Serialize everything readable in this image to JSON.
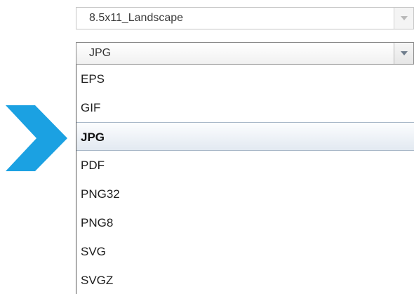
{
  "paper_size": {
    "value": "8.5x11_Landscape",
    "arrow_icon": "chevron-down-icon"
  },
  "format": {
    "value": "JPG",
    "arrow_icon": "chevron-down-icon",
    "options": [
      "EPS",
      "GIF",
      "JPG",
      "PDF",
      "PNG32",
      "PNG8",
      "SVG",
      "SVGZ"
    ],
    "selected": "JPG"
  },
  "pointer": {
    "icon": "chevron-right-icon",
    "color": "#1ba1e2"
  }
}
